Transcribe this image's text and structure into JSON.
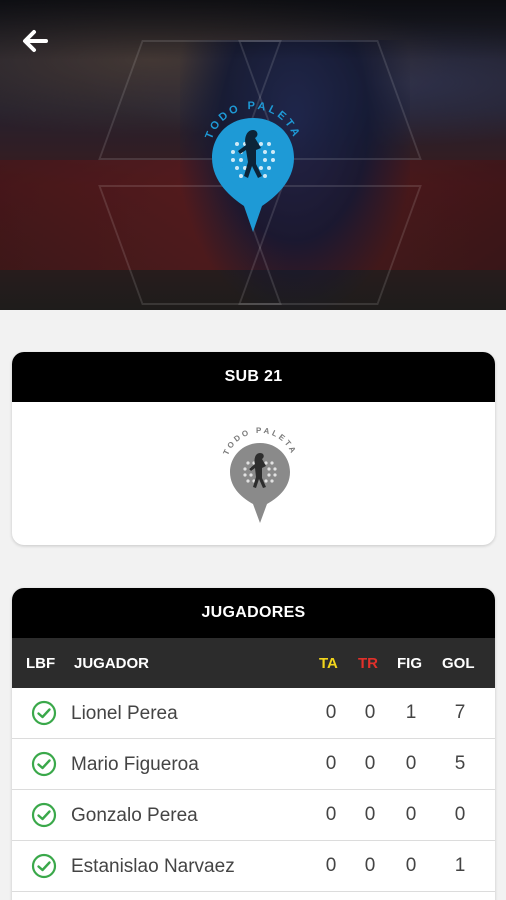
{
  "header": {
    "back_icon": "arrow-left-icon"
  },
  "team_card": {
    "title": "SUB 21"
  },
  "logo_text": "TODO PALETA",
  "players_card": {
    "title": "JUGADORES",
    "columns": {
      "lbf": "LBF",
      "player": "JUGADOR",
      "ta": "TA",
      "tr": "TR",
      "fig": "FIG",
      "gol": "GOL"
    },
    "column_colors": {
      "ta": "#f2d51b",
      "tr": "#e0302a"
    },
    "rows": [
      {
        "name": "Lionel Perea",
        "ta": "0",
        "tr": "0",
        "fig": "1",
        "gol": "7",
        "verified": true
      },
      {
        "name": "Mario Figueroa",
        "ta": "0",
        "tr": "0",
        "fig": "0",
        "gol": "5",
        "verified": true
      },
      {
        "name": "Gonzalo Perea",
        "ta": "0",
        "tr": "0",
        "fig": "0",
        "gol": "0",
        "verified": true
      },
      {
        "name": "Estanislao Narvaez",
        "ta": "0",
        "tr": "0",
        "fig": "0",
        "gol": "1",
        "verified": true
      }
    ]
  },
  "colors": {
    "accent_blue": "#1e9ad6",
    "check_green": "#3aa84a"
  }
}
